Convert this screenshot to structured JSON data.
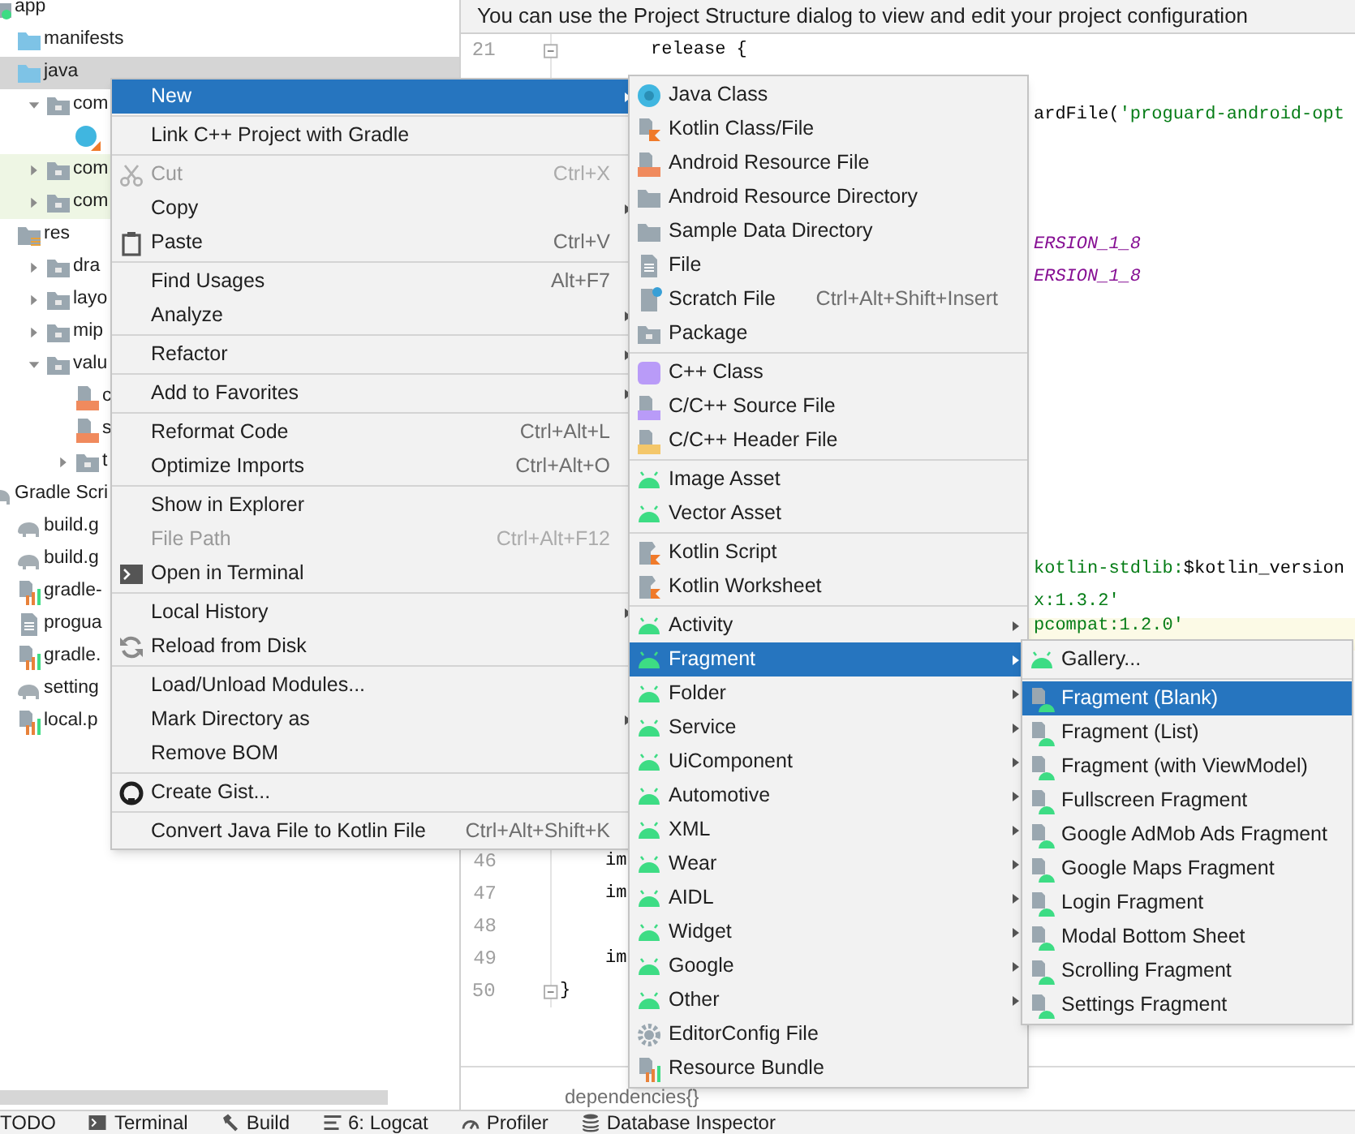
{
  "project_tree": [
    {
      "label": "app",
      "kind": "module",
      "selected": false,
      "highlighted": false,
      "children": [
        {
          "label": "manifests",
          "kind": "source_folder",
          "selected": false,
          "highlighted": false
        },
        {
          "label": "java",
          "kind": "source_folder",
          "selected": true,
          "highlighted": false,
          "children": [
            {
              "label": "com",
              "kind": "package",
              "expanded": true,
              "selected": false,
              "highlighted": false,
              "children": [
                {
                  "kind": "class",
                  "selected": false,
                  "highlighted": false
                }
              ]
            },
            {
              "label": "com",
              "kind": "package",
              "expanded": false,
              "selected": false,
              "highlighted": true
            },
            {
              "label": "com",
              "kind": "package",
              "expanded": false,
              "selected": false,
              "highlighted": true
            }
          ]
        },
        {
          "label": "res",
          "kind": "res_folder",
          "selected": false,
          "highlighted": false,
          "children": [
            {
              "label": "dra",
              "kind": "package",
              "expanded": false,
              "selected": false,
              "highlighted": false
            },
            {
              "label": "layo",
              "kind": "package",
              "expanded": false,
              "selected": false,
              "highlighted": false
            },
            {
              "label": "mip",
              "kind": "package",
              "expanded": false,
              "selected": false,
              "highlighted": false
            },
            {
              "label": "valu",
              "kind": "package",
              "expanded": true,
              "selected": false,
              "highlighted": false,
              "children": [
                {
                  "label": "c",
                  "kind": "xml",
                  "selected": false,
                  "highlighted": false
                },
                {
                  "label": "s",
                  "kind": "xml",
                  "selected": false,
                  "highlighted": false
                },
                {
                  "label": "t",
                  "kind": "package",
                  "expanded": false,
                  "selected": false,
                  "highlighted": false
                }
              ]
            }
          ]
        }
      ]
    },
    {
      "label": "Gradle Scri",
      "kind": "gradle",
      "selected": false,
      "highlighted": false,
      "children": [
        {
          "label": "build.g",
          "kind": "gradle",
          "selected": false,
          "highlighted": false
        },
        {
          "label": "build.g",
          "kind": "gradle",
          "selected": false,
          "highlighted": false
        },
        {
          "label": "gradle-",
          "kind": "properties",
          "selected": false,
          "highlighted": false
        },
        {
          "label": "progua",
          "kind": "text",
          "selected": false,
          "highlighted": false
        },
        {
          "label": "gradle.",
          "kind": "properties",
          "selected": false,
          "highlighted": false
        },
        {
          "label": "setting",
          "kind": "gradle",
          "selected": false,
          "highlighted": false
        },
        {
          "label": "local.p",
          "kind": "properties",
          "selected": false,
          "highlighted": false
        }
      ]
    }
  ],
  "editor": {
    "banner": "You can use the Project Structure dialog to view and edit your project configuration",
    "lines": [
      {
        "number": "21",
        "highlighted": false,
        "segments": [
          {
            "kind": "plain",
            "text": "release {"
          }
        ]
      },
      {
        "highlighted": false,
        "segments": [
          {
            "kind": "plain",
            "text": "ardFile("
          },
          {
            "kind": "string",
            "text": "'proguard-android-opt"
          }
        ]
      },
      {
        "highlighted": false,
        "segments": [
          {
            "kind": "constant",
            "text": "ERSION_1_8"
          }
        ]
      },
      {
        "highlighted": false,
        "segments": [
          {
            "kind": "constant",
            "text": "ERSION_1_8"
          }
        ]
      },
      {
        "highlighted": false,
        "segments": [
          {
            "kind": "string",
            "text": "kotlin-stdlib:"
          },
          {
            "kind": "plain",
            "text": "$kotlin_version"
          }
        ]
      },
      {
        "highlighted": false,
        "segments": [
          {
            "kind": "string",
            "text": "x:1.3.2'"
          }
        ]
      },
      {
        "highlighted": true,
        "segments": [
          {
            "kind": "string",
            "text": "pcompat:1.2.0'"
          }
        ]
      },
      {
        "highlighted": false,
        "number": "46",
        "segments": [
          {
            "kind": "plain",
            "text": "im"
          }
        ]
      },
      {
        "highlighted": false,
        "number": "47",
        "segments": [
          {
            "kind": "plain",
            "text": "im"
          }
        ]
      },
      {
        "highlighted": false,
        "number": "48"
      },
      {
        "highlighted": false,
        "number": "49",
        "segments": [
          {
            "kind": "plain",
            "text": "im"
          }
        ]
      },
      {
        "highlighted": false,
        "number": "50",
        "segments": [
          {
            "kind": "plain",
            "text": "}"
          }
        ]
      }
    ],
    "breadcrumb": "dependencies{}"
  },
  "context_menu": {
    "groups": [
      [
        {
          "label": "New",
          "submenu": true,
          "selected": true,
          "disabled": false
        }
      ],
      [
        {
          "label": "Link C++ Project with Gradle",
          "submenu": false,
          "selected": false,
          "disabled": false
        }
      ],
      [
        {
          "label": "Cut",
          "shortcut": "Ctrl+X",
          "submenu": false,
          "selected": false,
          "disabled": true
        },
        {
          "label": "Copy",
          "submenu": true,
          "selected": false,
          "disabled": false
        },
        {
          "label": "Paste",
          "shortcut": "Ctrl+V",
          "submenu": false,
          "selected": false,
          "disabled": false
        }
      ],
      [
        {
          "label": "Find Usages",
          "shortcut": "Alt+F7",
          "submenu": false,
          "selected": false,
          "disabled": false
        },
        {
          "label": "Analyze",
          "submenu": true,
          "selected": false,
          "disabled": false
        }
      ],
      [
        {
          "label": "Refactor",
          "submenu": true,
          "selected": false,
          "disabled": false
        }
      ],
      [
        {
          "label": "Add to Favorites",
          "submenu": true,
          "selected": false,
          "disabled": false
        }
      ],
      [
        {
          "label": "Reformat Code",
          "shortcut": "Ctrl+Alt+L",
          "submenu": false,
          "selected": false,
          "disabled": false
        },
        {
          "label": "Optimize Imports",
          "shortcut": "Ctrl+Alt+O",
          "submenu": false,
          "selected": false,
          "disabled": false
        }
      ],
      [
        {
          "label": "Show in Explorer",
          "submenu": false,
          "selected": false,
          "disabled": false
        },
        {
          "label": "File Path",
          "shortcut": "Ctrl+Alt+F12",
          "submenu": false,
          "selected": false,
          "disabled": true
        },
        {
          "label": "Open in Terminal",
          "submenu": false,
          "selected": false,
          "disabled": false
        }
      ],
      [
        {
          "label": "Local History",
          "submenu": true,
          "selected": false,
          "disabled": false
        },
        {
          "label": "Reload from Disk",
          "submenu": false,
          "selected": false,
          "disabled": false
        }
      ],
      [
        {
          "label": "Load/Unload Modules...",
          "submenu": false,
          "selected": false,
          "disabled": false
        },
        {
          "label": "Mark Directory as",
          "submenu": true,
          "selected": false,
          "disabled": false
        },
        {
          "label": "Remove BOM",
          "submenu": false,
          "selected": false,
          "disabled": false
        }
      ],
      [
        {
          "label": "Create Gist...",
          "submenu": false,
          "selected": false,
          "disabled": false
        }
      ],
      [
        {
          "label": "Convert Java File to Kotlin File",
          "shortcut": "Ctrl+Alt+Shift+K",
          "submenu": false,
          "selected": false,
          "disabled": false
        }
      ]
    ]
  },
  "new_submenu": {
    "groups": [
      [
        {
          "label": "Java Class",
          "submenu": false,
          "selected": false
        },
        {
          "label": "Kotlin Class/File",
          "submenu": false,
          "selected": false
        },
        {
          "label": "Android Resource File",
          "submenu": false,
          "selected": false
        },
        {
          "label": "Android Resource Directory",
          "submenu": false,
          "selected": false
        },
        {
          "label": "Sample Data Directory",
          "submenu": false,
          "selected": false
        },
        {
          "label": "File",
          "submenu": false,
          "selected": false
        },
        {
          "label": "Scratch File",
          "shortcut": "Ctrl+Alt+Shift+Insert",
          "submenu": false,
          "selected": false
        },
        {
          "label": "Package",
          "submenu": false,
          "selected": false
        }
      ],
      [
        {
          "label": "C++ Class",
          "submenu": false,
          "selected": false
        },
        {
          "label": "C/C++ Source File",
          "submenu": false,
          "selected": false
        },
        {
          "label": "C/C++ Header File",
          "submenu": false,
          "selected": false
        }
      ],
      [
        {
          "label": "Image Asset",
          "submenu": false,
          "selected": false
        },
        {
          "label": "Vector Asset",
          "submenu": false,
          "selected": false
        }
      ],
      [
        {
          "label": "Kotlin Script",
          "submenu": false,
          "selected": false
        },
        {
          "label": "Kotlin Worksheet",
          "submenu": false,
          "selected": false
        }
      ],
      [
        {
          "label": "Activity",
          "submenu": true,
          "selected": false
        },
        {
          "label": "Fragment",
          "submenu": true,
          "selected": true
        },
        {
          "label": "Folder",
          "submenu": true,
          "selected": false
        },
        {
          "label": "Service",
          "submenu": true,
          "selected": false
        },
        {
          "label": "UiComponent",
          "submenu": true,
          "selected": false
        },
        {
          "label": "Automotive",
          "submenu": true,
          "selected": false
        },
        {
          "label": "XML",
          "submenu": true,
          "selected": false
        },
        {
          "label": "Wear",
          "submenu": true,
          "selected": false
        },
        {
          "label": "AIDL",
          "submenu": true,
          "selected": false
        },
        {
          "label": "Widget",
          "submenu": true,
          "selected": false
        },
        {
          "label": "Google",
          "submenu": true,
          "selected": false
        },
        {
          "label": "Other",
          "submenu": true,
          "selected": false
        },
        {
          "label": "EditorConfig File",
          "submenu": false,
          "selected": false
        },
        {
          "label": "Resource Bundle",
          "submenu": false,
          "selected": false
        }
      ]
    ]
  },
  "fragment_submenu": {
    "groups": [
      [
        {
          "label": "Gallery...",
          "submenu": false,
          "selected": false
        }
      ],
      [
        {
          "label": "Fragment (Blank)",
          "submenu": false,
          "selected": true
        },
        {
          "label": "Fragment (List)",
          "submenu": false,
          "selected": false
        },
        {
          "label": "Fragment (with ViewModel)",
          "submenu": false,
          "selected": false
        },
        {
          "label": "Fullscreen Fragment",
          "submenu": false,
          "selected": false
        },
        {
          "label": "Google AdMob Ads Fragment",
          "submenu": false,
          "selected": false
        },
        {
          "label": "Google Maps Fragment",
          "submenu": false,
          "selected": false
        },
        {
          "label": "Login Fragment",
          "submenu": false,
          "selected": false
        },
        {
          "label": "Modal Bottom Sheet",
          "submenu": false,
          "selected": false
        },
        {
          "label": "Scrolling Fragment",
          "submenu": false,
          "selected": false
        },
        {
          "label": "Settings Fragment",
          "submenu": false,
          "selected": false
        }
      ]
    ]
  },
  "tool_window_bar": [
    "TODO",
    "Terminal",
    "Build",
    "6: Logcat",
    "Profiler",
    "Database Inspector"
  ]
}
